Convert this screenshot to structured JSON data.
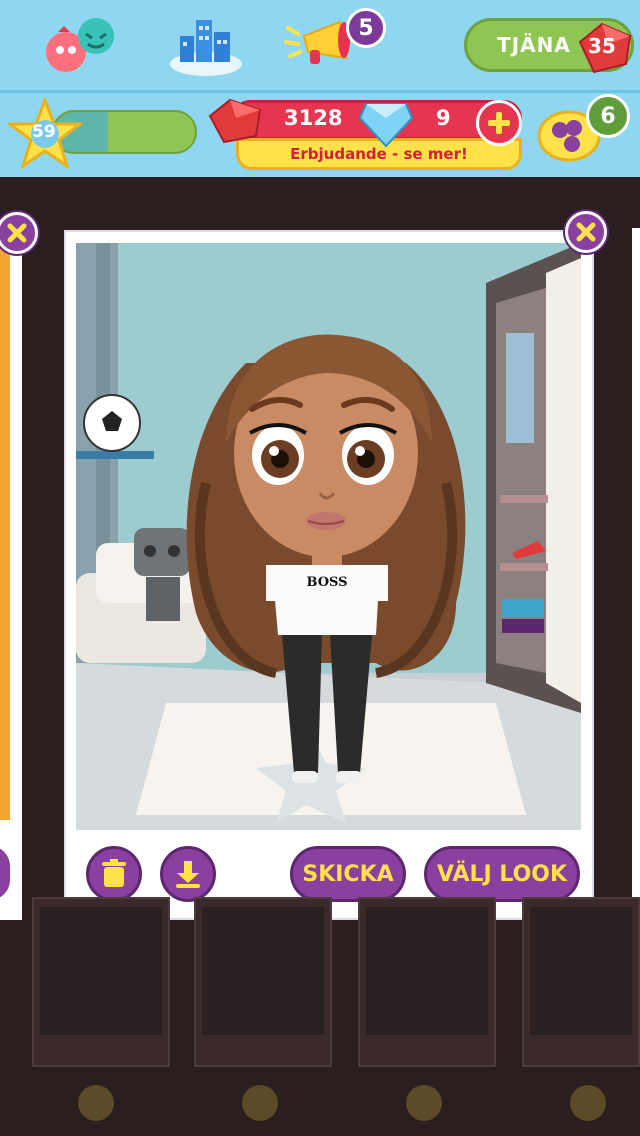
{
  "topbar": {
    "friends_icon": "friends-icon",
    "city_icon": "city-icon",
    "news_icon": "megaphone-icon",
    "news_count": "5",
    "earn_label": "TJÄNA",
    "earn_count": "35"
  },
  "stats": {
    "level": "59",
    "xp_progress": 0.38,
    "rubies": "3128",
    "diamonds": "9",
    "offer_text": "Erbjudande - se mer!",
    "momo_count": "6"
  },
  "card": {
    "shirt_text": "BOSS",
    "send_label": "SKICKA",
    "choose_look_label": "VÄLJ LOOK"
  },
  "colors": {
    "sky": "#8fd6f0",
    "purple": "#8b3f9e",
    "yellow": "#ffe24a",
    "green": "#8fc552",
    "red": "#e63551"
  }
}
